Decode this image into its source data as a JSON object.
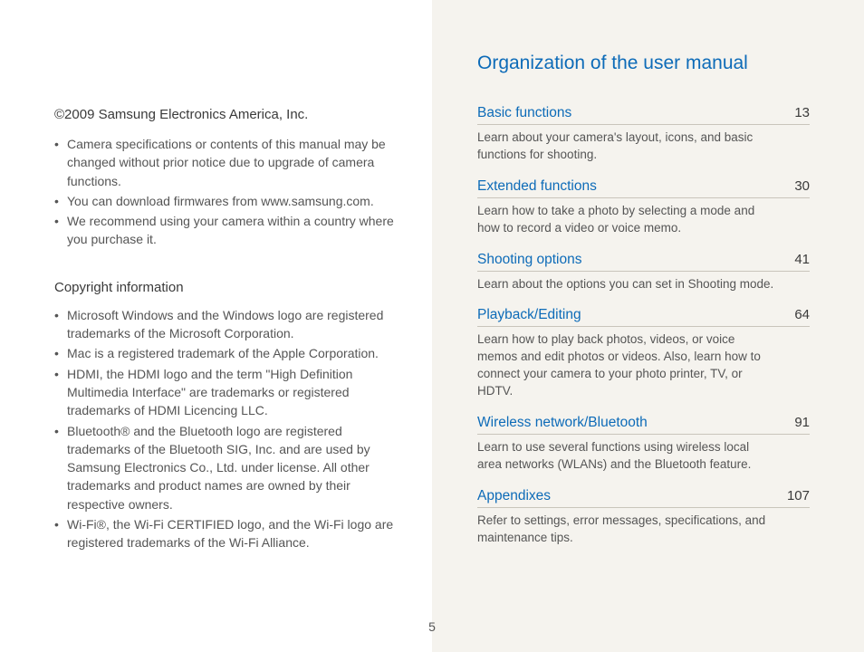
{
  "page_number": "5",
  "left": {
    "company_line": "©2009 Samsung Electronics America, Inc.",
    "notices": [
      "Camera specifications or contents of this manual may be changed without prior notice due to upgrade of camera functions.",
      "You can download firmwares from www.samsung.com.",
      "We recommend using your camera within a country where you purchase it."
    ],
    "copyright_heading": "Copyright information",
    "copyright_items": [
      "Microsoft Windows and the Windows logo are registered trademarks of the Microsoft Corporation.",
      "Mac is a registered trademark of the Apple Corporation.",
      "HDMI, the HDMI logo and the term \"High Definition Multimedia Interface\" are trademarks or registered trademarks of HDMI Licencing LLC.",
      "Bluetooth® and the Bluetooth logo are registered trademarks of the Bluetooth SIG, Inc. and are used by Samsung Electronics Co., Ltd. under license. All other trademarks and product names are owned by their respective owners.",
      "Wi-Fi®, the Wi-Fi CERTIFIED logo, and the Wi-Fi logo are registered trademarks of the Wi-Fi Alliance."
    ]
  },
  "right": {
    "title": "Organization of the user manual",
    "sections": [
      {
        "label": "Basic functions",
        "page": "13",
        "desc": "Learn about your camera's layout, icons, and basic functions for shooting."
      },
      {
        "label": "Extended functions",
        "page": "30",
        "desc": "Learn how to take a photo by selecting a mode and how to record a video or voice memo."
      },
      {
        "label": "Shooting options",
        "page": "41",
        "desc": "Learn about the options you can set in Shooting mode."
      },
      {
        "label": "Playback/Editing",
        "page": "64",
        "desc": "Learn how to play back photos, videos, or voice memos and edit photos or videos. Also, learn how to connect your camera to your photo printer, TV, or HDTV."
      },
      {
        "label": "Wireless network/Bluetooth",
        "page": "91",
        "desc": "Learn to use several functions using wireless local area networks (WLANs) and the Bluetooth feature."
      },
      {
        "label": "Appendixes",
        "page": "107",
        "desc": "Refer to settings, error messages, specifications, and maintenance tips."
      }
    ]
  }
}
